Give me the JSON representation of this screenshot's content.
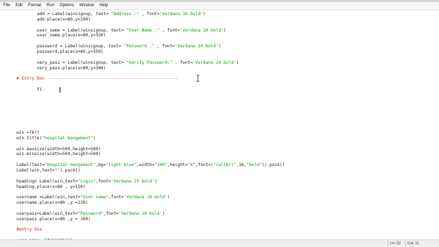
{
  "menu": [
    "File",
    "Edit",
    "Format",
    "Run",
    "Options",
    "Window",
    "Help"
  ],
  "status": {
    "line": "Ln: 52",
    "col": "Col: 11"
  },
  "code_lines": [
    [
      {
        "t": "        add = Label(winsignup, text= ",
        "c": "def"
      },
      {
        "t": "\"Address :\"",
        "c": "str"
      },
      {
        "t": " , font=",
        "c": "def"
      },
      {
        "t": "'Verdana 10 bold'",
        "c": "str"
      },
      {
        "t": ")",
        "c": "def"
      }
    ],
    [
      {
        "t": "        add.place(x=80,y=290)",
        "c": "def"
      }
    ],
    [],
    [
      {
        "t": "        user_name = Label(winsignup, text= ",
        "c": "def"
      },
      {
        "t": "\"User Name :\"",
        "c": "str"
      },
      {
        "t": " , font=",
        "c": "def"
      },
      {
        "t": "'Verdana 10 bold'",
        "c": "str"
      },
      {
        "t": ")",
        "c": "def"
      }
    ],
    [
      {
        "t": "        user_name.place(x=80,y=320)",
        "c": "def"
      }
    ],
    [],
    [
      {
        "t": "        password = Label(winsignup, text= ",
        "c": "def"
      },
      {
        "t": "\"Password :\"",
        "c": "str"
      },
      {
        "t": " , font=",
        "c": "def"
      },
      {
        "t": "'Verdana 10 bold'",
        "c": "str"
      },
      {
        "t": ")",
        "c": "def"
      }
    ],
    [
      {
        "t": "        password.place(x=80,y=350)",
        "c": "def"
      }
    ],
    [],
    [
      {
        "t": "        very_pass = Label(winsignup, text= ",
        "c": "def"
      },
      {
        "t": "\"Verify Password:\"",
        "c": "str"
      },
      {
        "t": " , font=",
        "c": "def"
      },
      {
        "t": "'Verdana 10 bold'",
        "c": "str"
      },
      {
        "t": ")",
        "c": "def"
      }
    ],
    [
      {
        "t": "        very_pass.place(x=80,y=380)",
        "c": "def"
      }
    ],
    [],
    [
      {
        "t": "# Entry Box ---------------------------------------------------",
        "c": "cmt"
      }
    ],
    [],
    [
      {
        "t": "        fi",
        "c": "def"
      }
    ],
    [],
    [],
    [],
    [],
    [],
    [],
    [],
    [
      {
        "t": "win =Tk()",
        "c": "def"
      }
    ],
    [
      {
        "t": "win.title(",
        "c": "def"
      },
      {
        "t": "\"hospital mangement\"",
        "c": "str"
      },
      {
        "t": ")",
        "c": "def"
      }
    ],
    [],
    [
      {
        "t": "win.maxsize(width=500,height=500)",
        "c": "def"
      }
    ],
    [
      {
        "t": "win.minsize(width=500,height=500)",
        "c": "def"
      }
    ],
    [],
    [
      {
        "t": "Label(text=",
        "c": "def"
      },
      {
        "t": "\"Hospital mangement\"",
        "c": "str"
      },
      {
        "t": ",bg=",
        "c": "def"
      },
      {
        "t": "\"light blue\"",
        "c": "str"
      },
      {
        "t": ",width=",
        "c": "def"
      },
      {
        "t": "\"300\"",
        "c": "str"
      },
      {
        "t": ",height=",
        "c": "def"
      },
      {
        "t": "\"4\"",
        "c": "str"
      },
      {
        "t": ",font=(",
        "c": "def"
      },
      {
        "t": "\"calibri\"",
        "c": "str"
      },
      {
        "t": ",16,",
        "c": "def"
      },
      {
        "t": "\"bold\"",
        "c": "str"
      },
      {
        "t": ")).pack()",
        "c": "def"
      }
    ],
    [
      {
        "t": "Label(win,text=",
        "c": "def"
      },
      {
        "t": "\"\"",
        "c": "str"
      },
      {
        "t": ").pack()",
        "c": "def"
      }
    ],
    [],
    [
      {
        "t": "heading= Label(win,text=",
        "c": "def"
      },
      {
        "t": "\"Login\"",
        "c": "str"
      },
      {
        "t": ",font=",
        "c": "def"
      },
      {
        "t": "'Verdana 25 bold'",
        "c": "str"
      },
      {
        "t": ")",
        "c": "def"
      }
    ],
    [
      {
        "t": "heading.place(x=80 , y=150)",
        "c": "def"
      }
    ],
    [],
    [
      {
        "t": "username =Label(win,text=",
        "c": "def"
      },
      {
        "t": "\"User name\"",
        "c": "str"
      },
      {
        "t": ",font=",
        "c": "def"
      },
      {
        "t": "'Verdana 10 bold'",
        "c": "str"
      },
      {
        "t": ")",
        "c": "def"
      }
    ],
    [
      {
        "t": "username.place(x=80 ,y =220)",
        "c": "def"
      }
    ],
    [],
    [
      {
        "t": "userpass=Label(win,text=",
        "c": "def"
      },
      {
        "t": "\"Password\"",
        "c": "str"
      },
      {
        "t": ",font=",
        "c": "def"
      },
      {
        "t": "'Verdana 10 bold'",
        "c": "str"
      },
      {
        "t": ")",
        "c": "def"
      }
    ],
    [
      {
        "t": "userpass.place(x=80 ,y = 260)",
        "c": "def"
      }
    ],
    [],
    [
      {
        "t": "#entry box",
        "c": "cmt"
      }
    ],
    [],
    [
      {
        "t": "user_name =StringVar()",
        "c": "def"
      }
    ]
  ]
}
